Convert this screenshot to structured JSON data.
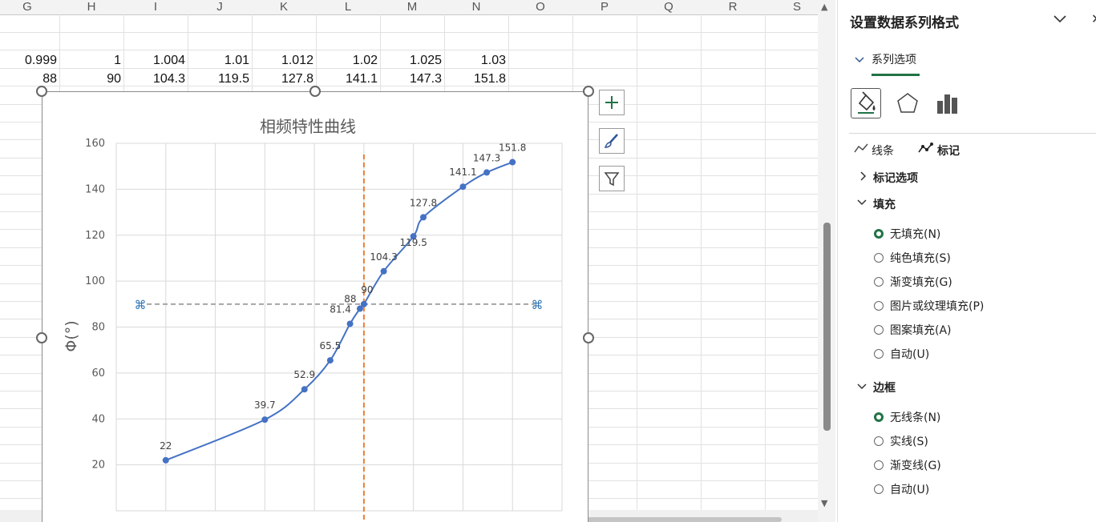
{
  "sheet": {
    "columns": [
      "G",
      "H",
      "I",
      "J",
      "K",
      "L",
      "M",
      "N",
      "O",
      "P",
      "Q",
      "R",
      "S"
    ],
    "row1": [
      "0.999",
      "1",
      "1.004",
      "1.01",
      "1.012",
      "1.02",
      "1.025",
      "1.03"
    ],
    "row2": [
      "88",
      "90",
      "104.3",
      "119.5",
      "127.8",
      "141.1",
      "147.3",
      "151.8"
    ]
  },
  "chart": {
    "title": "相频特性曲线",
    "ylabel": "Φ(°)",
    "buttons": {
      "add": "chart-elements-plus-icon",
      "style": "chart-styles-brush-icon",
      "filter": "chart-filter-funnel-icon"
    }
  },
  "chart_data": {
    "type": "scatter",
    "title": "相频特性曲线",
    "xlabel": "",
    "ylabel": "Φ(°)",
    "ylim": [
      0,
      160
    ],
    "yticks": [
      "20",
      "40",
      "60",
      "80",
      "100",
      "120",
      "140",
      "160"
    ],
    "grid": true,
    "series": [
      {
        "color": "#4472c4",
        "smooth": true,
        "points": [
          {
            "x": 0.9,
            "y": 22,
            "label": "22"
          },
          {
            "x": 0.95,
            "y": 39.7,
            "label": "39.7"
          },
          {
            "x": 0.97,
            "y": 52.9,
            "label": "52.9"
          },
          {
            "x": 0.983,
            "y": 65.5,
            "label": "65.5"
          },
          {
            "x": 0.993,
            "y": 81.4,
            "label": "81.4"
          },
          {
            "x": 0.998,
            "y": 88,
            "label": "88"
          },
          {
            "x": 1.0,
            "y": 90,
            "label": "90"
          },
          {
            "x": 1.01,
            "y": 104.3,
            "label": "104.3"
          },
          {
            "x": 1.025,
            "y": 119.5,
            "label": "119.5"
          },
          {
            "x": 1.03,
            "y": 127.8,
            "label": "127.8"
          },
          {
            "x": 1.05,
            "y": 141.1,
            "label": "141.1"
          },
          {
            "x": 1.062,
            "y": 147.3,
            "label": "147.3"
          },
          {
            "x": 1.075,
            "y": 151.8,
            "label": "151.8"
          }
        ]
      }
    ],
    "reference_lines": [
      {
        "orientation": "vertical",
        "x": 1.0,
        "color": "#ed7d31",
        "style": "dashed"
      },
      {
        "orientation": "horizontal",
        "y": 90,
        "color": "#a5a5a5",
        "style": "dashed"
      }
    ]
  },
  "pane": {
    "title": "设置数据系列格式",
    "tab_label": "系列选项",
    "icons": [
      "fill-line-icon",
      "effects-pentagon-icon",
      "series-options-bar-icon"
    ],
    "line_tab": "线条",
    "marker_tab": "标记",
    "marker_options": "标记选项",
    "fill_section": "填充",
    "fill_options": [
      {
        "label": "无填充(N)",
        "selected": true
      },
      {
        "label": "纯色填充(S)",
        "selected": false
      },
      {
        "label": "渐变填充(G)",
        "selected": false
      },
      {
        "label": "图片或纹理填充(P)",
        "selected": false
      },
      {
        "label": "图案填充(A)",
        "selected": false
      },
      {
        "label": "自动(U)",
        "selected": false
      }
    ],
    "border_section": "边框",
    "border_options": [
      {
        "label": "无线条(N)",
        "selected": true
      },
      {
        "label": "实线(S)",
        "selected": false
      },
      {
        "label": "渐变线(G)",
        "selected": false
      },
      {
        "label": "自动(U)",
        "selected": false
      }
    ],
    "accent": "#217346"
  }
}
